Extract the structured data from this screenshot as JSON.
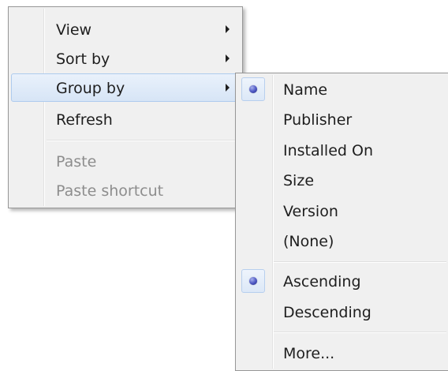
{
  "context_menu": {
    "items": [
      {
        "label": "View",
        "has_submenu": true,
        "enabled": true
      },
      {
        "label": "Sort by",
        "has_submenu": true,
        "enabled": true
      },
      {
        "label": "Group by",
        "has_submenu": true,
        "enabled": true,
        "highlighted": true
      },
      {
        "label": "Refresh",
        "has_submenu": false,
        "enabled": true
      },
      {
        "label": "Paste",
        "has_submenu": false,
        "enabled": false
      },
      {
        "label": "Paste shortcut",
        "has_submenu": false,
        "enabled": false
      }
    ]
  },
  "group_by_submenu": {
    "items": [
      {
        "label": "Name",
        "checked": true
      },
      {
        "label": "Publisher",
        "checked": false
      },
      {
        "label": "Installed On",
        "checked": false
      },
      {
        "label": "Size",
        "checked": false
      },
      {
        "label": "Version",
        "checked": false
      },
      {
        "label": "(None)",
        "checked": false
      },
      {
        "label": "Ascending",
        "checked": true
      },
      {
        "label": "Descending",
        "checked": false
      },
      {
        "label": "More...",
        "checked": false
      }
    ]
  },
  "colors": {
    "menu_background": "#f0f0f0",
    "menu_border": "#979797",
    "highlight_border": "#aecbee",
    "disabled_text": "#8d8d8d",
    "radio_bullet": "#4b55c2"
  },
  "icons": {
    "submenu_arrow": "triangle-right",
    "radio_bullet": "radio-dot"
  }
}
